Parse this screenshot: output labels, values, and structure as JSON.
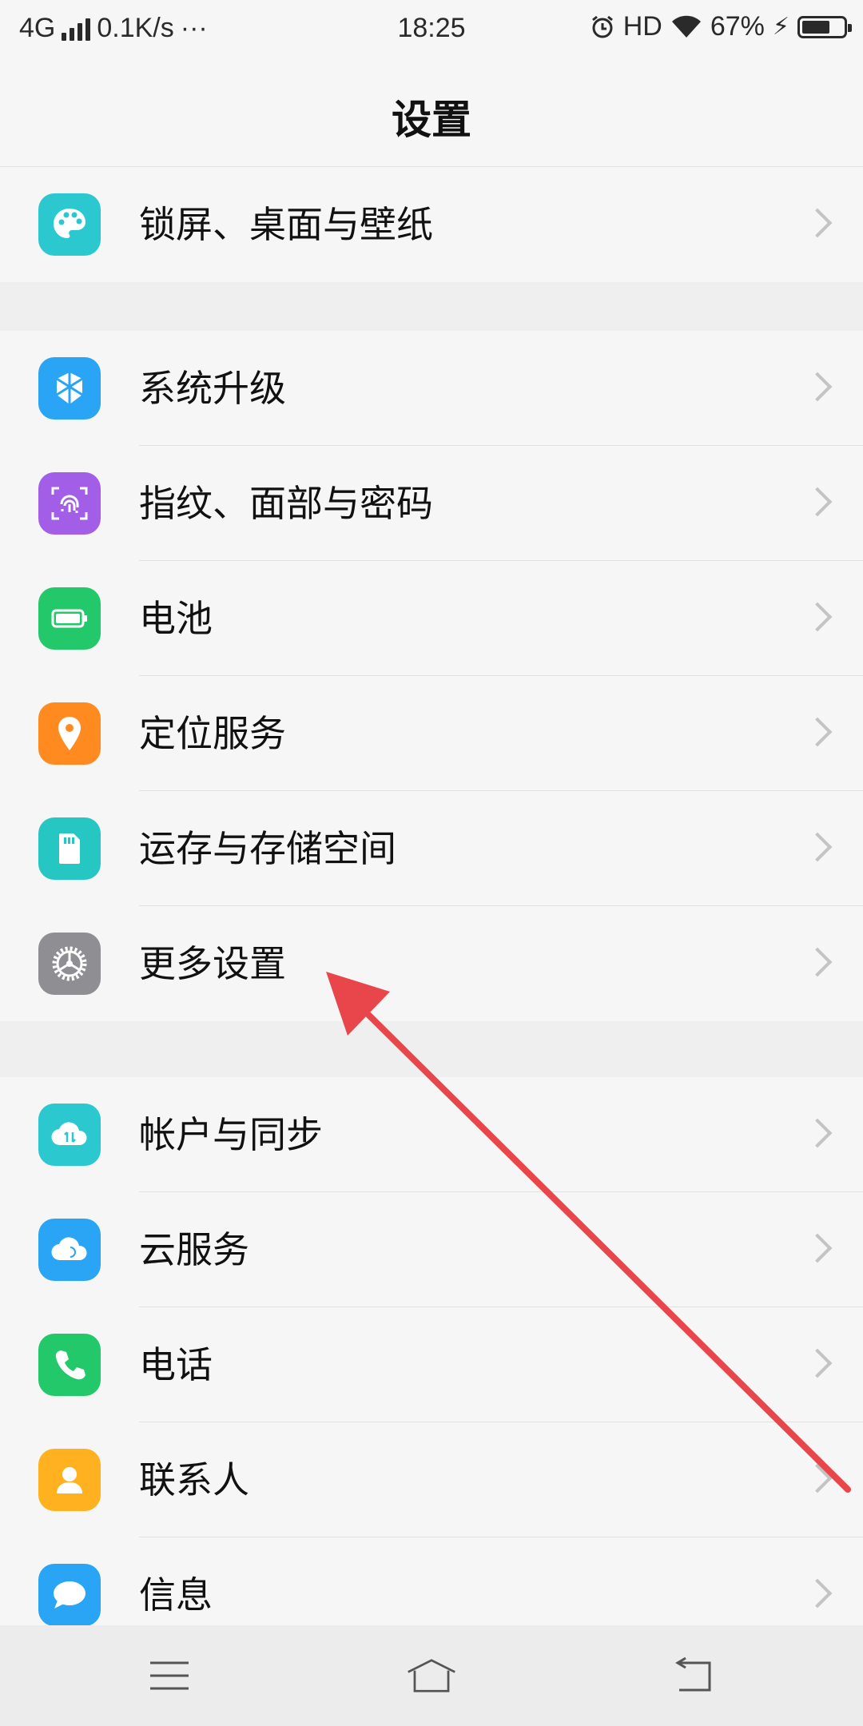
{
  "status_bar": {
    "network": "4G",
    "speed": "0.1K/s",
    "more": "···",
    "time": "18:25",
    "hd": "HD",
    "battery": "67%",
    "battery_level": 0.67
  },
  "header": {
    "title": "设置"
  },
  "sections": [
    {
      "items": [
        {
          "label": "锁屏、桌面与壁纸",
          "icon": "palette-icon",
          "color": "#2bc8cf"
        }
      ]
    },
    {
      "items": [
        {
          "label": "系统升级",
          "icon": "upgrade-icon",
          "color": "#2aa4f4"
        },
        {
          "label": "指纹、面部与密码",
          "icon": "fingerprint-icon",
          "color": "#a35ee8"
        },
        {
          "label": "电池",
          "icon": "battery-icon",
          "color": "#22c86a"
        },
        {
          "label": "定位服务",
          "icon": "location-pin-icon",
          "color": "#ff8a1f"
        },
        {
          "label": "运存与存储空间",
          "icon": "sd-card-icon",
          "color": "#26c7c2"
        },
        {
          "label": "更多设置",
          "icon": "gear-icon",
          "color": "#8e8e93"
        }
      ]
    },
    {
      "items": [
        {
          "label": "帐户与同步",
          "icon": "cloud-sync-icon",
          "color": "#2bc8cf"
        },
        {
          "label": "云服务",
          "icon": "cloud-icon",
          "color": "#2aa4f4"
        },
        {
          "label": "电话",
          "icon": "phone-icon",
          "color": "#22c86a"
        },
        {
          "label": "联系人",
          "icon": "contact-icon",
          "color": "#ffb11f"
        },
        {
          "label": "信息",
          "icon": "message-icon",
          "color": "#2aa4f4"
        }
      ]
    }
  ],
  "nav": {
    "menu": "menu-icon",
    "home": "home-icon",
    "back": "back-icon"
  },
  "annotation": {
    "color": "#e8464a"
  }
}
